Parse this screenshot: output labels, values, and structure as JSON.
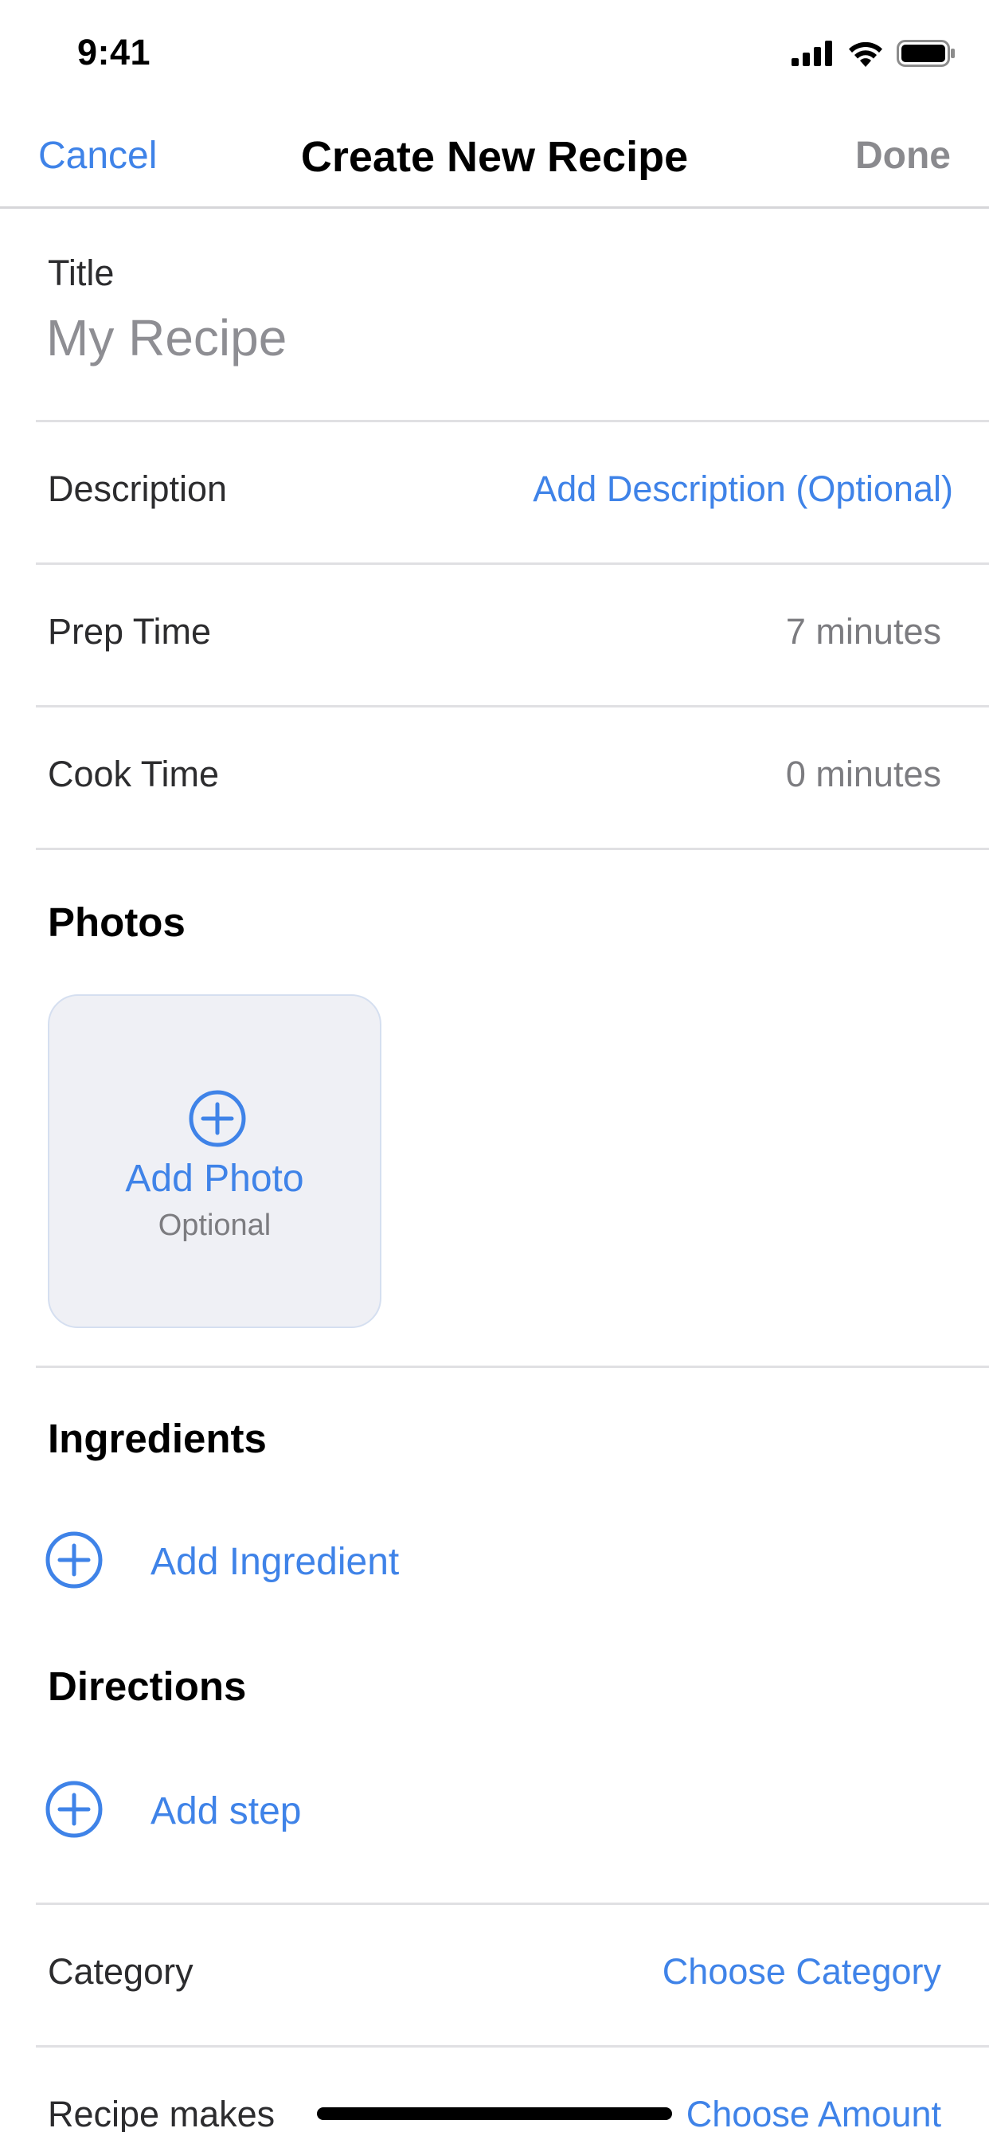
{
  "status_bar": {
    "time": "9:41",
    "icons": [
      "cellular-signal-icon",
      "wifi-icon",
      "battery-icon"
    ]
  },
  "nav": {
    "cancel_label": "Cancel",
    "title": "Create New Recipe",
    "done_label": "Done"
  },
  "form": {
    "title": {
      "label": "Title",
      "placeholder": "My Recipe",
      "value": ""
    },
    "description": {
      "label": "Description",
      "action": "Add Description (Optional)"
    },
    "prep_time": {
      "label": "Prep Time",
      "value": "7 minutes"
    },
    "cook_time": {
      "label": "Cook Time",
      "value": "0 minutes"
    }
  },
  "photos": {
    "heading": "Photos",
    "add_label": "Add Photo",
    "add_sublabel": "Optional"
  },
  "ingredients": {
    "heading": "Ingredients",
    "add_label": "Add Ingredient"
  },
  "directions": {
    "heading": "Directions",
    "add_label": "Add step"
  },
  "category": {
    "label": "Category",
    "action": "Choose Category"
  },
  "recipe_makes": {
    "label": "Recipe makes",
    "action": "Choose Amount"
  },
  "colors": {
    "accent": "#3f83e8",
    "secondary_text": "#7c7c80",
    "divider": "#e0e0e3",
    "photo_card_bg": "#eff0f5"
  }
}
